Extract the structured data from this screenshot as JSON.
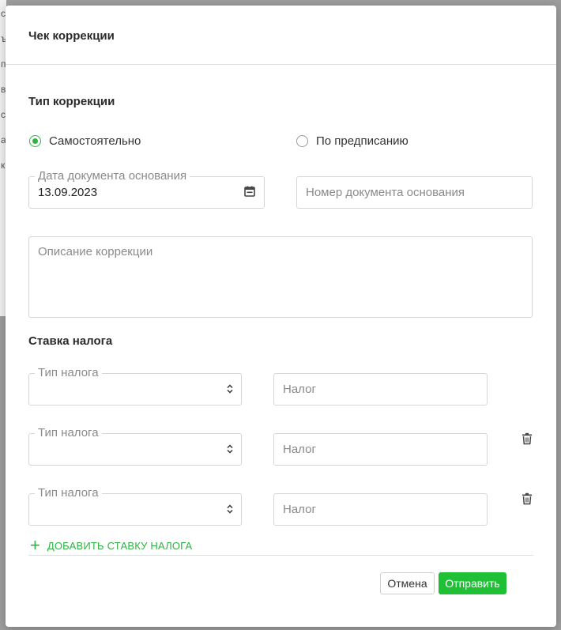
{
  "modal": {
    "title": "Чек коррекции"
  },
  "correction_type": {
    "title": "Тип коррекции",
    "options": [
      {
        "label": "Самостоятельно",
        "checked": true
      },
      {
        "label": "По предписанию",
        "checked": false
      }
    ]
  },
  "document": {
    "date_label": "Дата документа основания",
    "date_value": "13.09.2023",
    "number_placeholder": "Номер документа основания",
    "description_placeholder": "Описание коррекции"
  },
  "tax_rate": {
    "title": "Ставка налога",
    "rows": [
      {
        "type_label": "Тип налога",
        "tax_placeholder": "Налог",
        "deletable": false
      },
      {
        "type_label": "Тип налога",
        "tax_placeholder": "Налог",
        "deletable": true
      },
      {
        "type_label": "Тип налога",
        "tax_placeholder": "Налог",
        "deletable": true
      }
    ],
    "add_label": "ДОБАВИТЬ СТАВКУ НАЛОГА"
  },
  "footer": {
    "cancel_label": "Отмена",
    "submit_label": "Отправить"
  },
  "colors": {
    "accent": "#2fb344",
    "submit": "#1fbf36"
  },
  "icons": {
    "calendar": "calendar-icon",
    "select": "select-arrows-icon",
    "trash": "trash-icon",
    "plus": "plus-icon"
  }
}
